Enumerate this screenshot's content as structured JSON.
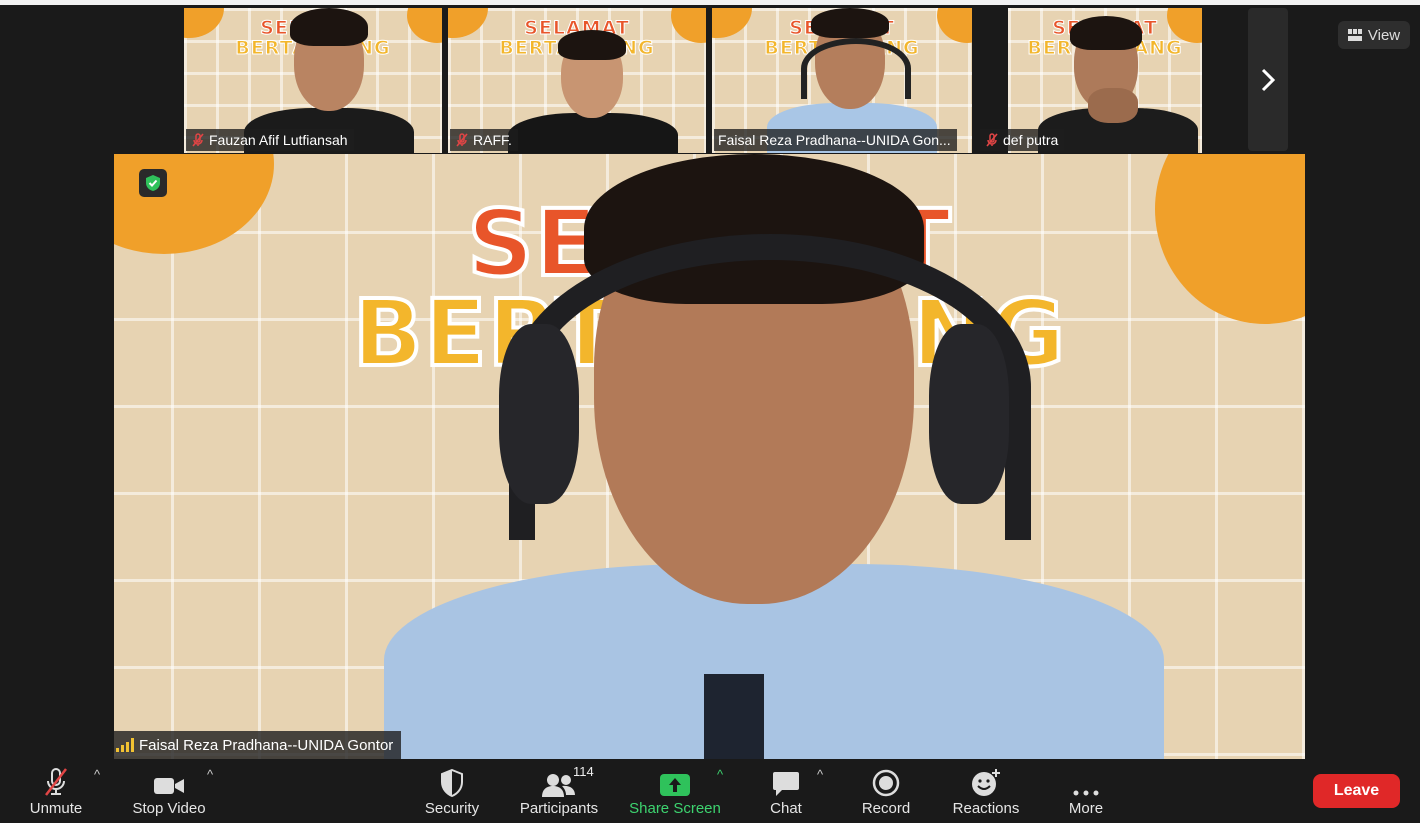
{
  "thumbnails": [
    {
      "name": "Fauzan Afif Lutfiansah",
      "muted": true,
      "active": false,
      "banner_l1": "SELAMAT",
      "banner_l2": "BERTANDANG"
    },
    {
      "name": "RAFF.",
      "muted": true,
      "active": false,
      "banner_l1": "SELAMAT",
      "banner_l2": "BERTANDANG"
    },
    {
      "name": "Faisal Reza Pradhana--UNIDA Gon...",
      "muted": false,
      "active": true,
      "banner_l1": "SELAMAT",
      "banner_l2": "BERTANDANG"
    },
    {
      "name": "def putra",
      "muted": true,
      "active": false,
      "banner_l1": "SELAMAT",
      "banner_l2": "BERTANDANG"
    }
  ],
  "view_button": {
    "label": "View",
    "icon": "grid-icon"
  },
  "pager_icon": "chevron-right-icon",
  "main_video": {
    "speaker_name": "Faisal Reza Pradhana--UNIDA Gontor",
    "banner_l1": "SELAMAT",
    "banner_l2": "BERTANDANG",
    "signal_icon": "signal-bars-icon",
    "encryption_icon": "shield-check-icon"
  },
  "toolbar": {
    "unmute": "Unmute",
    "stop_video": "Stop Video",
    "security": "Security",
    "participants": "Participants",
    "participants_count": "114",
    "share_screen": "Share Screen",
    "chat": "Chat",
    "record": "Record",
    "reactions": "Reactions",
    "more": "More",
    "leave": "Leave"
  },
  "colors": {
    "leave_red": "#e02828",
    "share_green": "#3dd36f",
    "active_border": "#c9e36e",
    "backdrop_orange": "#f0a02a"
  }
}
